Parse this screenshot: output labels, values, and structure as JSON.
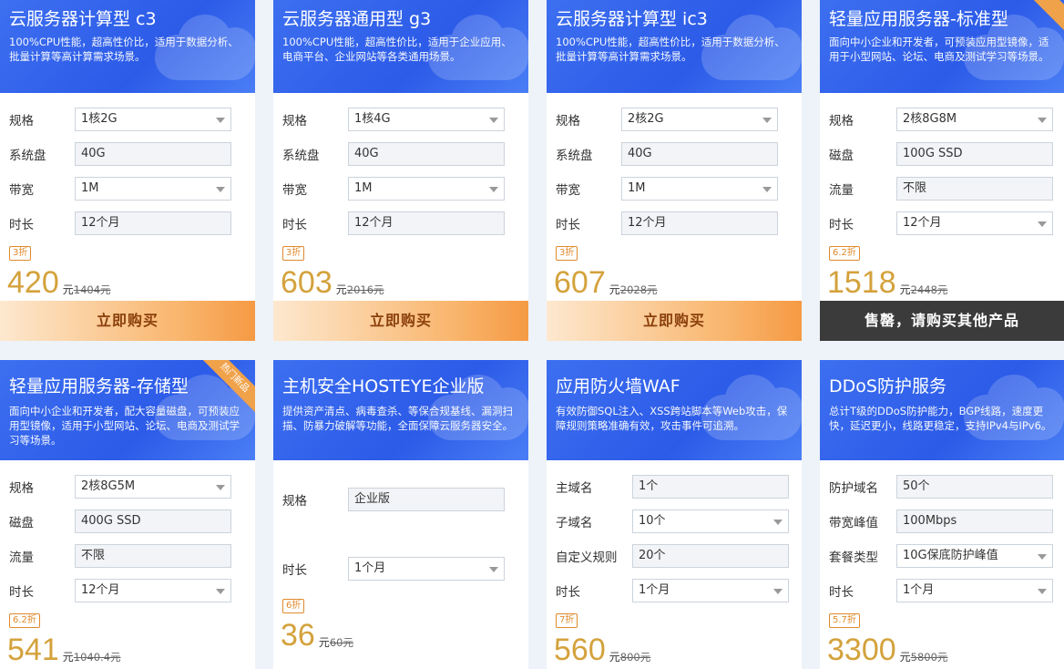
{
  "labels": {
    "currency": "元"
  },
  "cards": [
    {
      "title": "云服务器计算型 c3",
      "desc": "100%CPU性能，超高性价比，适用于数据分析、批量计算等高计算需求场景。",
      "fields": [
        {
          "label": "规格",
          "value": "1核2G"
        },
        {
          "label": "系统盘",
          "value": "40G"
        },
        {
          "label": "带宽",
          "value": "1M"
        },
        {
          "label": "时长",
          "value": "12个月"
        }
      ],
      "discount": "3折",
      "price": "420",
      "original": "1404元",
      "button": "立即购买"
    },
    {
      "title": "云服务器通用型 g3",
      "desc": "100%CPU性能，超高性价比，适用于企业应用、电商平台、企业网站等各类通用场景。",
      "fields": [
        {
          "label": "规格",
          "value": "1核4G"
        },
        {
          "label": "系统盘",
          "value": "40G"
        },
        {
          "label": "带宽",
          "value": "1M"
        },
        {
          "label": "时长",
          "value": "12个月"
        }
      ],
      "discount": "3折",
      "price": "603",
      "original": "2016元",
      "button": "立即购买"
    },
    {
      "title": "云服务器计算型 ic3",
      "desc": "100%CPU性能，超高性价比，适用于数据分析、批量计算等高计算需求场景。",
      "fields": [
        {
          "label": "规格",
          "value": "2核2G"
        },
        {
          "label": "系统盘",
          "value": "40G"
        },
        {
          "label": "带宽",
          "value": "1M"
        },
        {
          "label": "时长",
          "value": "12个月"
        }
      ],
      "discount": "3折",
      "price": "607",
      "original": "2028元",
      "button": "立即购买"
    },
    {
      "title": "轻量应用服务器-标准型",
      "desc": "面向中小企业和开发者，可预装应用型镜像，适用于小型网站、论坛、电商及测试学习等场景。",
      "fields": [
        {
          "label": "规格",
          "value": "2核8G8M"
        },
        {
          "label": "磁盘",
          "value": "100G SSD"
        },
        {
          "label": "流量",
          "value": "不限"
        },
        {
          "label": "时长",
          "value": "12个月"
        }
      ],
      "discount": "6.2折",
      "price": "1518",
      "original": "2448元",
      "button": "售罄，请购买其他产品"
    },
    {
      "title": "轻量应用服务器-存储型",
      "desc": "面向中小企业和开发者，配大容量磁盘，可预装应用型镜像，适用于小型网站、论坛、电商及测试学习等场景。",
      "ribbon": "热门新品",
      "fields": [
        {
          "label": "规格",
          "value": "2核8G5M"
        },
        {
          "label": "磁盘",
          "value": "400G SSD"
        },
        {
          "label": "流量",
          "value": "不限"
        },
        {
          "label": "时长",
          "value": "12个月"
        }
      ],
      "discount": "6.2折",
      "price": "541",
      "original": "1040.4元"
    },
    {
      "title": "主机安全HOSTEYE企业版",
      "desc": "提供资产清点、病毒查杀、等保合规基线、漏洞扫描、防暴力破解等功能，全面保障云服务器安全。",
      "fields": [
        {
          "label": "规格",
          "value": "企业版"
        },
        {
          "label": "时长",
          "value": "1个月"
        }
      ],
      "discount": "6折",
      "price": "36",
      "original": "60元"
    },
    {
      "title": "应用防火墙WAF",
      "desc": "有效防御SQL注入、XSS跨站脚本等Web攻击，保障规则策略准确有效，攻击事件可追溯。",
      "fields": [
        {
          "label": "主域名",
          "value": "1个"
        },
        {
          "label": "子域名",
          "value": "10个"
        },
        {
          "label": "自定义规则",
          "value": "20个"
        },
        {
          "label": "时长",
          "value": "1个月"
        }
      ],
      "discount": "7折",
      "price": "560",
      "original": "800元"
    },
    {
      "title": "DDoS防护服务",
      "desc": "总计T级的DDoS防护能力，BGP线路，速度更快，延迟更小，线路更稳定，支持IPv4与IPv6。",
      "fields": [
        {
          "label": "防护域名",
          "value": "50个"
        },
        {
          "label": "带宽峰值",
          "value": "100Mbps"
        },
        {
          "label": "套餐类型",
          "value": "10G保底防护峰值"
        },
        {
          "label": "时长",
          "value": "1个月"
        }
      ],
      "discount": "5.7折",
      "price": "3300",
      "original": "5800元"
    }
  ]
}
